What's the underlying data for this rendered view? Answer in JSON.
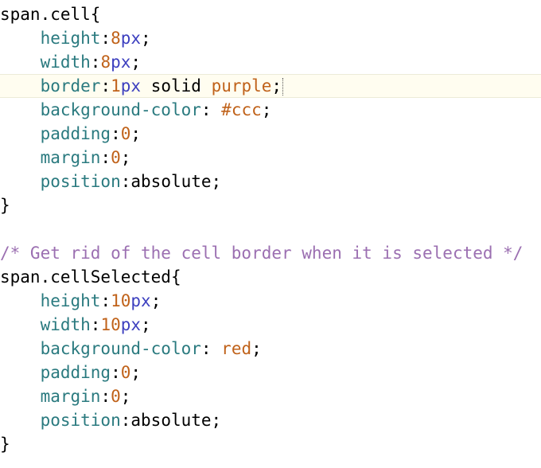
{
  "editor": {
    "lines": [
      {
        "tokens": [
          {
            "t": "span.cell",
            "c": "sel"
          },
          {
            "t": "{",
            "c": "brace"
          }
        ]
      },
      {
        "tokens": [
          {
            "t": "    ",
            "c": "plain"
          },
          {
            "t": "height",
            "c": "prop"
          },
          {
            "t": ":",
            "c": "punct"
          },
          {
            "t": "8",
            "c": "num"
          },
          {
            "t": "px",
            "c": "unit"
          },
          {
            "t": ";",
            "c": "punct"
          }
        ]
      },
      {
        "tokens": [
          {
            "t": "    ",
            "c": "plain"
          },
          {
            "t": "width",
            "c": "prop"
          },
          {
            "t": ":",
            "c": "punct"
          },
          {
            "t": "8",
            "c": "num"
          },
          {
            "t": "px",
            "c": "unit"
          },
          {
            "t": ";",
            "c": "punct"
          }
        ]
      },
      {
        "current": true,
        "caret": true,
        "tokens": [
          {
            "t": "    ",
            "c": "plain"
          },
          {
            "t": "border",
            "c": "prop"
          },
          {
            "t": ":",
            "c": "punct"
          },
          {
            "t": "1",
            "c": "num"
          },
          {
            "t": "px",
            "c": "unit"
          },
          {
            "t": " solid ",
            "c": "plain"
          },
          {
            "t": "purple",
            "c": "kw"
          },
          {
            "t": ";",
            "c": "punct"
          }
        ]
      },
      {
        "tokens": [
          {
            "t": "    ",
            "c": "plain"
          },
          {
            "t": "background-color",
            "c": "prop"
          },
          {
            "t": ": ",
            "c": "punct"
          },
          {
            "t": "#ccc",
            "c": "kw"
          },
          {
            "t": ";",
            "c": "punct"
          }
        ]
      },
      {
        "tokens": [
          {
            "t": "    ",
            "c": "plain"
          },
          {
            "t": "padding",
            "c": "prop"
          },
          {
            "t": ":",
            "c": "punct"
          },
          {
            "t": "0",
            "c": "num"
          },
          {
            "t": ";",
            "c": "punct"
          }
        ]
      },
      {
        "tokens": [
          {
            "t": "    ",
            "c": "plain"
          },
          {
            "t": "margin",
            "c": "prop"
          },
          {
            "t": ":",
            "c": "punct"
          },
          {
            "t": "0",
            "c": "num"
          },
          {
            "t": ";",
            "c": "punct"
          }
        ]
      },
      {
        "tokens": [
          {
            "t": "    ",
            "c": "plain"
          },
          {
            "t": "position",
            "c": "prop"
          },
          {
            "t": ":",
            "c": "punct"
          },
          {
            "t": "absolute",
            "c": "plain"
          },
          {
            "t": ";",
            "c": "punct"
          }
        ]
      },
      {
        "tokens": [
          {
            "t": "}",
            "c": "brace"
          }
        ]
      },
      {
        "tokens": []
      },
      {
        "tokens": [
          {
            "t": "/* Get rid of the cell border when it is selected */",
            "c": "comment"
          }
        ]
      },
      {
        "tokens": [
          {
            "t": "span.cellSelected",
            "c": "sel"
          },
          {
            "t": "{",
            "c": "brace"
          }
        ]
      },
      {
        "tokens": [
          {
            "t": "    ",
            "c": "plain"
          },
          {
            "t": "height",
            "c": "prop"
          },
          {
            "t": ":",
            "c": "punct"
          },
          {
            "t": "10",
            "c": "num"
          },
          {
            "t": "px",
            "c": "unit"
          },
          {
            "t": ";",
            "c": "punct"
          }
        ]
      },
      {
        "tokens": [
          {
            "t": "    ",
            "c": "plain"
          },
          {
            "t": "width",
            "c": "prop"
          },
          {
            "t": ":",
            "c": "punct"
          },
          {
            "t": "10",
            "c": "num"
          },
          {
            "t": "px",
            "c": "unit"
          },
          {
            "t": ";",
            "c": "punct"
          }
        ]
      },
      {
        "tokens": [
          {
            "t": "    ",
            "c": "plain"
          },
          {
            "t": "background-color",
            "c": "prop"
          },
          {
            "t": ": ",
            "c": "punct"
          },
          {
            "t": "red",
            "c": "kw"
          },
          {
            "t": ";",
            "c": "punct"
          }
        ]
      },
      {
        "tokens": [
          {
            "t": "    ",
            "c": "plain"
          },
          {
            "t": "padding",
            "c": "prop"
          },
          {
            "t": ":",
            "c": "punct"
          },
          {
            "t": "0",
            "c": "num"
          },
          {
            "t": ";",
            "c": "punct"
          }
        ]
      },
      {
        "tokens": [
          {
            "t": "    ",
            "c": "plain"
          },
          {
            "t": "margin",
            "c": "prop"
          },
          {
            "t": ":",
            "c": "punct"
          },
          {
            "t": "0",
            "c": "num"
          },
          {
            "t": ";",
            "c": "punct"
          }
        ]
      },
      {
        "tokens": [
          {
            "t": "    ",
            "c": "plain"
          },
          {
            "t": "position",
            "c": "prop"
          },
          {
            "t": ":",
            "c": "punct"
          },
          {
            "t": "absolute",
            "c": "plain"
          },
          {
            "t": ";",
            "c": "punct"
          }
        ]
      },
      {
        "tokens": [
          {
            "t": "}",
            "c": "brace"
          }
        ]
      }
    ]
  },
  "colors": {
    "property": "#2a7a7f",
    "number": "#c0621a",
    "unit": "#3c3fbf",
    "keyword_value": "#c0621a",
    "comment": "#9b6fb1",
    "current_line_bg": "#fffdf0"
  }
}
